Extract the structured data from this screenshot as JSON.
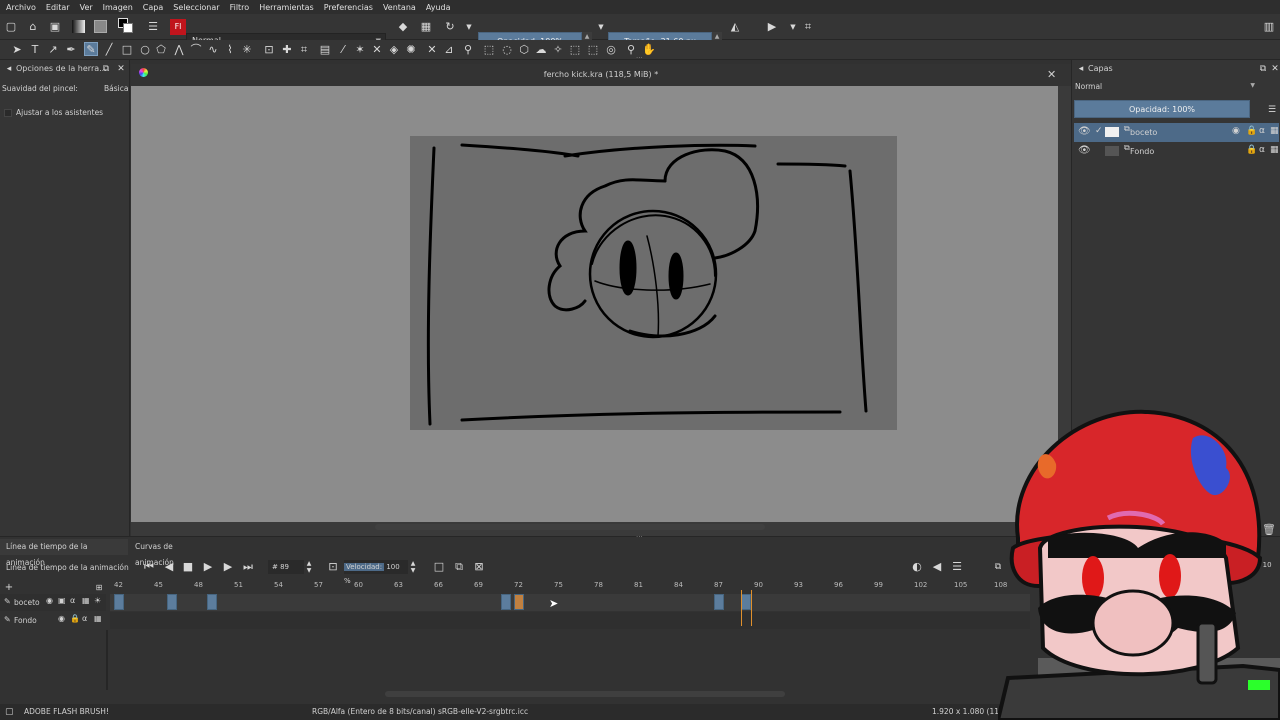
{
  "menu": [
    "Archivo",
    "Editar",
    "Ver",
    "Imagen",
    "Capa",
    "Seleccionar",
    "Filtro",
    "Herramientas",
    "Preferencias",
    "Ventana",
    "Ayuda"
  ],
  "toolbar": {
    "blend_mode": "Normal",
    "opacity": "Opacidad: 100%",
    "size": "Tamaño: 31,60 px",
    "brush_badge": "Fl"
  },
  "left_panel": {
    "title": "Opciones de la herra...",
    "smoothing_label": "Suavidad del pincel:",
    "smoothing_value": "Básica",
    "assistants_label": "Ajustar a los asistentes"
  },
  "document": {
    "tab_title": "fercho kick.kra (118,5 MiB) *"
  },
  "layers_panel": {
    "title": "Capas",
    "blend_mode": "Normal",
    "opacity": "Opacidad: 100%",
    "layers": [
      {
        "name": "boceto",
        "selected": true
      },
      {
        "name": "Fondo",
        "selected": false
      }
    ]
  },
  "timeline": {
    "tabs": [
      "Línea de tiempo de la animación",
      "Curvas de animación"
    ],
    "header_label": "Línea de tiempo de la animación",
    "current_frame": "89",
    "speed_label": "Velocidad:",
    "speed_value": "100 %",
    "ruler": [
      "42",
      "45",
      "48",
      "51",
      "54",
      "57",
      "60",
      "63",
      "66",
      "69",
      "72",
      "75",
      "78",
      "81",
      "84",
      "87",
      "90",
      "93",
      "96",
      "99",
      "102",
      "105",
      "108"
    ],
    "layers": [
      "boceto",
      "Fondo"
    ],
    "keyframes_boceto": [
      42,
      46,
      49,
      71,
      87,
      89
    ],
    "keyframe_selected": 72,
    "right_count": "9  10"
  },
  "status": {
    "brush": "ADOBE FLASH BRUSH!",
    "color_model": "RGB/Alfa (Entero de 8 bits/canal)  sRGB-elle-V2-srgbtrc.icc",
    "dims": "1.920 x 1.080 (118,5 M"
  },
  "colors": {
    "accent": "#5b7b9b",
    "keyframe": "#5c7d9d",
    "keyframe_selected": "#c08040",
    "playhead": "#e0902c"
  }
}
